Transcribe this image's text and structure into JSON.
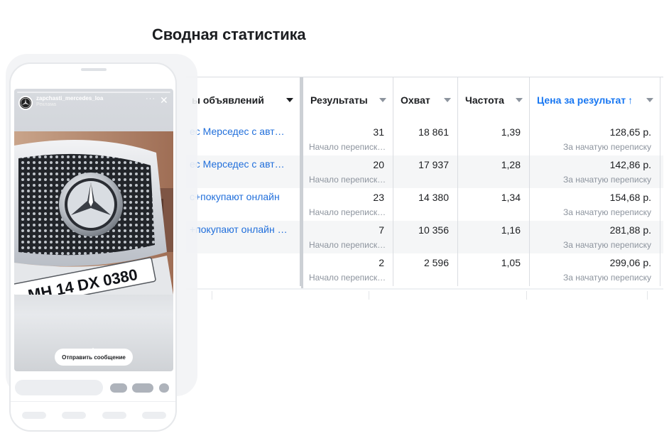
{
  "page_title": "Сводная статистика",
  "table": {
    "columns": {
      "name": "ы объявлений",
      "results": "Результаты",
      "reach": "Охват",
      "frequency": "Частота",
      "cost_per_result": "Цена за результат"
    },
    "sort_arrow": "↑",
    "rows": [
      {
        "name": "ес Мерседес с авт…",
        "results": "31",
        "results_sub": "Начало переписк…",
        "reach": "18 861",
        "frequency": "1,39",
        "cost": "128,65 р.",
        "cost_sub": "За начатую переписку"
      },
      {
        "name": "ес Мерседес с авт…",
        "results": "20",
        "results_sub": "Начало переписк…",
        "reach": "17 937",
        "frequency": "1,28",
        "cost": "142,86 р.",
        "cost_sub": "За начатую переписку"
      },
      {
        "name": "с+покупают онлайн",
        "results": "23",
        "results_sub": "Начало переписк…",
        "reach": "14 380",
        "frequency": "1,34",
        "cost": "154,68 р.",
        "cost_sub": "За начатую переписку"
      },
      {
        "name": "+покупают онлайн …",
        "results": "7",
        "results_sub": "Начало переписк…",
        "reach": "10 356",
        "frequency": "1,16",
        "cost": "281,88 р.",
        "cost_sub": "За начатую переписку"
      },
      {
        "name": "",
        "results": "2",
        "results_sub": "Начало переписк…",
        "reach": "2 596",
        "frequency": "1,05",
        "cost": "299,06 р.",
        "cost_sub": "За начатую переписку"
      }
    ]
  },
  "story": {
    "username": "zapchasti_mercedes_loa",
    "sponsored": "Реклама",
    "more": "···",
    "close": "✕",
    "plate": "MH 14 DX 0380",
    "chevron": "︿",
    "cta": "Отправить сообщение"
  },
  "icons": {
    "avatar": "mercedes-star-icon",
    "sort": "arrow-up-icon",
    "dropdown": "caret-down-icon"
  },
  "colors": {
    "accent": "#1877f2",
    "link": "#216fdb",
    "muted": "#8d949e"
  }
}
